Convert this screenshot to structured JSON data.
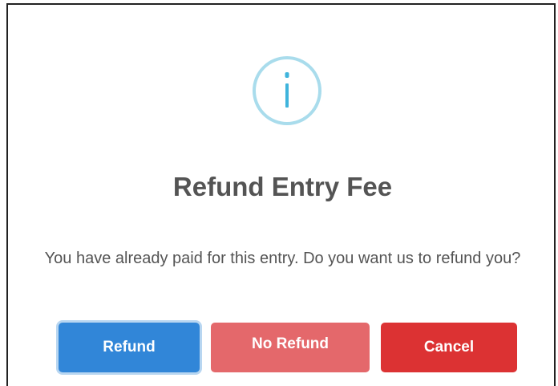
{
  "dialog": {
    "icon": "info-icon",
    "title": "Refund Entry Fee",
    "message": "You have already paid for this entry. Do you want us to refund you?",
    "buttons": {
      "refund": "Refund",
      "no_refund": "No Refund",
      "cancel": "Cancel"
    },
    "colors": {
      "icon_ring": "#a9dcec",
      "icon_glyph": "#3fb4dc",
      "refund": "#3186d8",
      "no_refund": "#e4686b",
      "cancel": "#dc3233",
      "text": "#545454"
    }
  }
}
